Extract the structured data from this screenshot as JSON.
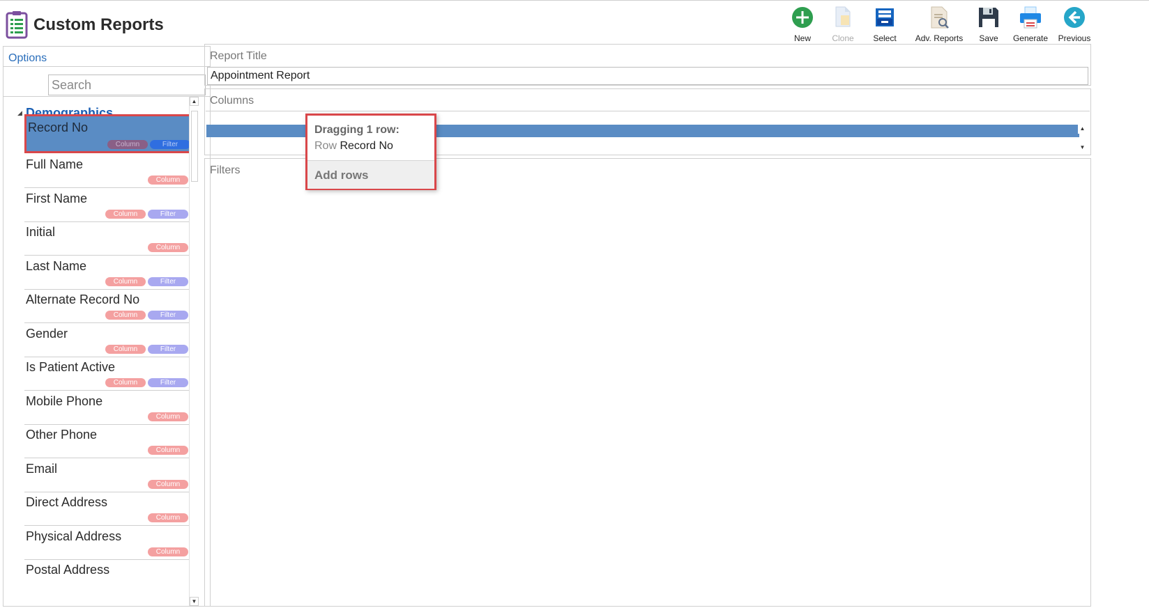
{
  "app": {
    "title": "Custom Reports",
    "icon": "report-list-icon"
  },
  "toolbar": {
    "new": {
      "label": "New",
      "icon": "plus-circle-icon",
      "color": "#2e9e4f"
    },
    "clone": {
      "label": "Clone",
      "icon": "clone-document-icon",
      "disabled": true
    },
    "select": {
      "label": "Select",
      "icon": "inbox-tray-icon",
      "color": "#1565c0"
    },
    "adv_reports": {
      "label": "Adv. Reports",
      "icon": "document-search-icon"
    },
    "save": {
      "label": "Save",
      "icon": "floppy-disk-icon",
      "color": "#2f3b4a"
    },
    "generate": {
      "label": "Generate",
      "icon": "printer-icon",
      "color": "#1e88e5"
    },
    "previous": {
      "label": "Previous",
      "icon": "arrow-left-circle-icon",
      "color": "#26a6c8"
    }
  },
  "options": {
    "label": "Options",
    "search_placeholder": "Search",
    "group": "Demographics",
    "column_badge": "Column",
    "filter_badge": "Filter",
    "fields": [
      {
        "name": "Record No",
        "column": true,
        "filter": true,
        "selected": true
      },
      {
        "name": "Full Name",
        "column": true,
        "filter": false
      },
      {
        "name": "First Name",
        "column": true,
        "filter": true
      },
      {
        "name": "Initial",
        "column": true,
        "filter": false
      },
      {
        "name": "Last Name",
        "column": true,
        "filter": true
      },
      {
        "name": "Alternate Record No",
        "column": true,
        "filter": true
      },
      {
        "name": "Gender",
        "column": true,
        "filter": true
      },
      {
        "name": "Is Patient Active",
        "column": true,
        "filter": true
      },
      {
        "name": "Mobile Phone",
        "column": true,
        "filter": false
      },
      {
        "name": "Other Phone",
        "column": true,
        "filter": false
      },
      {
        "name": "Email",
        "column": true,
        "filter": false
      },
      {
        "name": "Direct Address",
        "column": true,
        "filter": false
      },
      {
        "name": "Physical Address",
        "column": true,
        "filter": false
      },
      {
        "name": "Postal Address",
        "column": true,
        "filter": false
      }
    ]
  },
  "report_title": {
    "label": "Report Title",
    "value": "Appointment Report"
  },
  "columns": {
    "label": "Columns"
  },
  "filters": {
    "label": "Filters"
  },
  "drag": {
    "title": "Dragging 1 row:",
    "row_prefix": "Row",
    "row_name": "Record No",
    "action": "Add rows"
  },
  "colors": {
    "accent": "#1a5fb4",
    "highlight": "#5a8cc4",
    "outline": "#d9474a"
  }
}
